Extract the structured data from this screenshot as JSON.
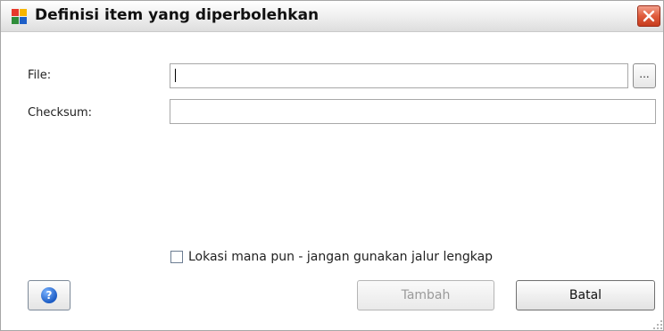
{
  "dialog": {
    "title": "Definisi item yang diperbolehkan",
    "close_icon": "close-icon",
    "app_icon": "avg-logo-icon"
  },
  "form": {
    "file_label": "File:",
    "file_value": "",
    "browse_label": "...",
    "checksum_label": "Checksum:",
    "checksum_value": "",
    "anywhere_checkbox_label": "Lokasi mana pun - jangan gunakan jalur lengkap",
    "anywhere_checked": false
  },
  "buttons": {
    "help_icon": "help-icon",
    "add_label": "Tambah",
    "add_enabled": false,
    "cancel_label": "Batal"
  },
  "colors": {
    "close_button": "#d8512f",
    "help_icon": "#1c5cc4",
    "disabled_text": "#9a9a9a"
  }
}
